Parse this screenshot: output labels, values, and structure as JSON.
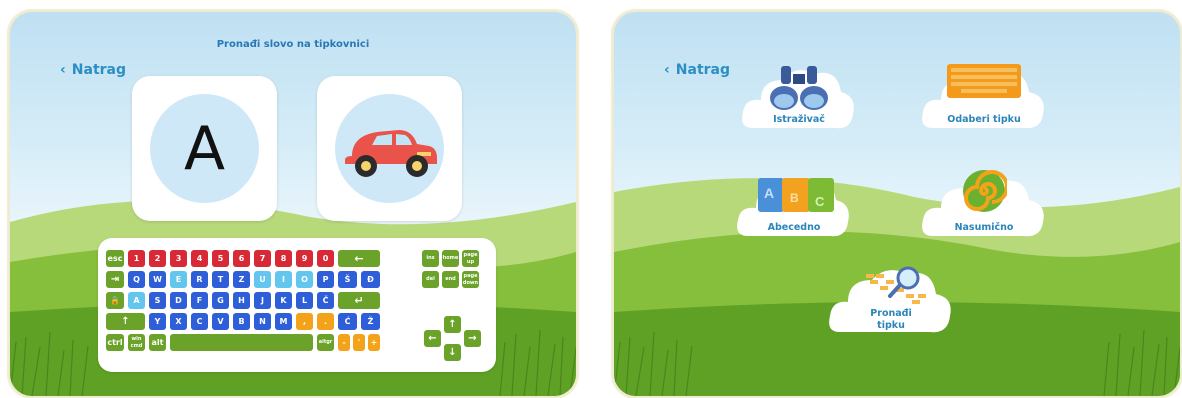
{
  "left": {
    "back_label": "Natrag",
    "title": "Pronađi slovo na tipkovnici",
    "letter": "A",
    "picture_icon": "car-icon",
    "keyboard": {
      "rows": [
        [
          "esc",
          "1",
          "2",
          "3",
          "4",
          "5",
          "6",
          "7",
          "8",
          "9",
          "0",
          "←"
        ],
        [
          "⇥",
          "Q",
          "W",
          "E",
          "R",
          "T",
          "Z",
          "U",
          "I",
          "O",
          "P",
          "Š",
          "Đ"
        ],
        [
          "🔒",
          "A",
          "S",
          "D",
          "F",
          "G",
          "H",
          "J",
          "K",
          "L",
          "Č",
          "↵"
        ],
        [
          "↑",
          "Y",
          "X",
          "C",
          "V",
          "B",
          "N",
          "M",
          ",",
          ".",
          "Ć",
          "Ž"
        ],
        [
          "ctrl",
          "win cmd",
          "alt",
          "",
          "altgr",
          "-",
          "'",
          "+"
        ]
      ],
      "nav_keys": [
        "ins",
        "home",
        "page up",
        "del",
        "end",
        "page down"
      ],
      "arrow_keys": [
        "↑",
        "←",
        "↓",
        "→"
      ]
    }
  },
  "right": {
    "back_label": "Natrag",
    "menu": [
      {
        "label": "Istraživač",
        "icon": "binoculars-icon"
      },
      {
        "label": "Odaberi tipku",
        "icon": "keyboard-icon"
      },
      {
        "label": "Abecedno",
        "icon": "puzzle-icon"
      },
      {
        "label": "Nasumično",
        "icon": "spiral-icon"
      },
      {
        "label": "Pronađi tipku",
        "icon": "magnifier-icon"
      }
    ]
  },
  "colors": {
    "key_red": "#d72a36",
    "key_blue": "#2e5ed8",
    "key_light_blue": "#62c6ef",
    "key_green": "#6aa22a",
    "key_orange": "#f3a21a",
    "label_blue": "#2a85b8"
  }
}
